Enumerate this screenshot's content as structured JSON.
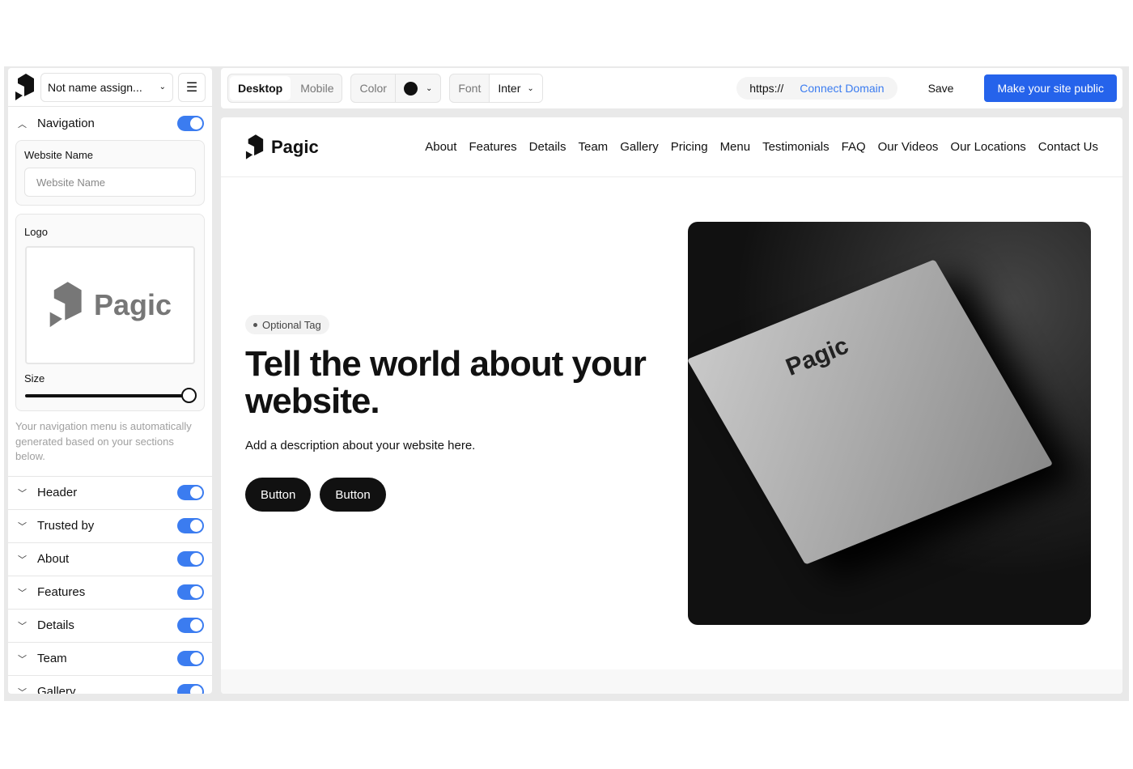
{
  "sidebar": {
    "project": "Not name assign...",
    "nav_section": "Navigation",
    "website_name_label": "Website Name",
    "website_name_placeholder": "Website Name",
    "logo_label": "Logo",
    "logo_text": "Pagic",
    "size_label": "Size",
    "size_value": 1.0,
    "hint": "Your navigation menu is automatically generated based on your sections below.",
    "sections": [
      {
        "label": "Header",
        "enabled": true
      },
      {
        "label": "Trusted by",
        "enabled": true
      },
      {
        "label": "About",
        "enabled": true
      },
      {
        "label": "Features",
        "enabled": true
      },
      {
        "label": "Details",
        "enabled": true
      },
      {
        "label": "Team",
        "enabled": true
      },
      {
        "label": "Gallery",
        "enabled": true
      }
    ]
  },
  "toolbar": {
    "desktop": "Desktop",
    "mobile": "Mobile",
    "color": "Color",
    "color_value": "#111111",
    "font": "Font",
    "font_value": "Inter",
    "url_prefix": "https://",
    "connect_domain": "Connect Domain",
    "save": "Save",
    "publish": "Make your site public"
  },
  "site": {
    "brand": "Pagic",
    "nav": [
      "About",
      "Features",
      "Details",
      "Team",
      "Gallery",
      "Pricing",
      "Menu",
      "Testimonials",
      "FAQ",
      "Our Videos",
      "Our Locations",
      "Contact Us"
    ],
    "tag": "Optional Tag",
    "title": "Tell the world about your website.",
    "description": "Add a description about your website here.",
    "buttons": [
      "Button",
      "Button"
    ],
    "image_logo": "Pagic"
  },
  "colors": {
    "accent": "#2563eb",
    "toggle": "#3b7cf0"
  }
}
